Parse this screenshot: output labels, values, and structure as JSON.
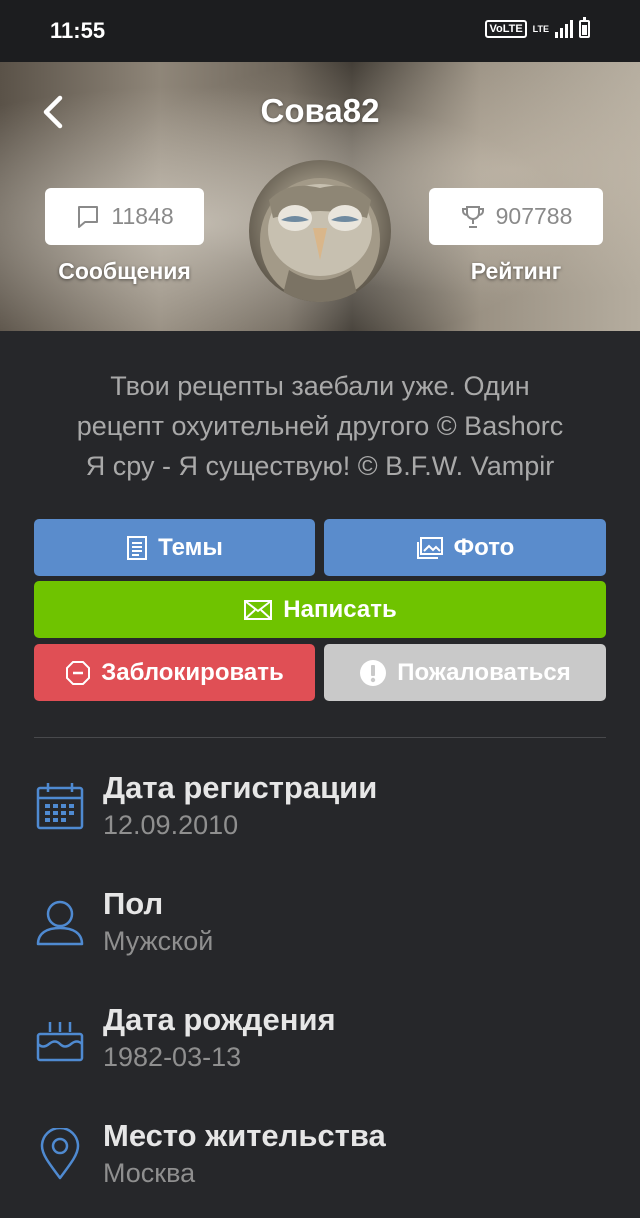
{
  "status_bar": {
    "time": "11:55",
    "volte": "VoLTE",
    "lte": "LTE"
  },
  "profile": {
    "username": "Сова82",
    "messages_count": "11848",
    "messages_label": "Сообщения",
    "rating_value": "907788",
    "rating_label": "Рейтинг"
  },
  "bio": [
    "Твои рецепты заебали уже. Один",
    "рецепт охуительней другого © Bashorc",
    "Я сру - Я существую! © B.F.W. Vampir"
  ],
  "buttons": {
    "topics": "Темы",
    "photo": "Фото",
    "write": "Написать",
    "block": "Заблокировать",
    "report": "Пожаловаться"
  },
  "info": [
    {
      "title": "Дата регистрации",
      "value": "12.09.2010",
      "icon": "calendar-icon"
    },
    {
      "title": "Пол",
      "value": "Мужской",
      "icon": "person-icon"
    },
    {
      "title": "Дата рождения",
      "value": "1982-03-13",
      "icon": "cake-icon"
    },
    {
      "title": "Место жительства",
      "value": "Москва",
      "icon": "location-pin-icon"
    }
  ],
  "colors": {
    "background": "#26272a",
    "blue_button": "#5a8ccc",
    "green_button": "#6fc300",
    "red_button": "#e04f55",
    "grey_button": "#c9c9c9",
    "icon_accent": "#4f8ad1"
  }
}
